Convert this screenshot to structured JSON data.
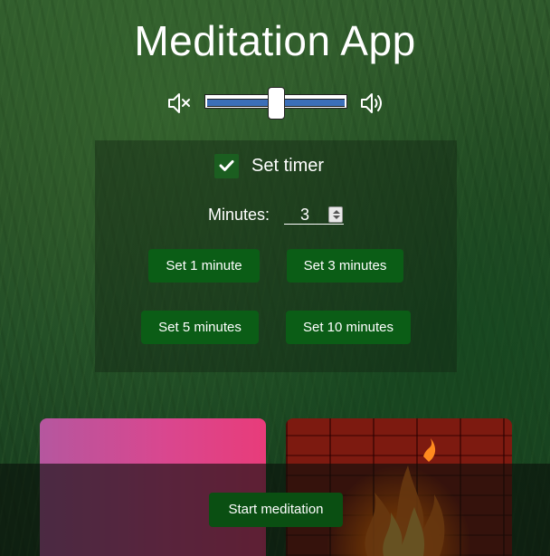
{
  "app": {
    "title": "Meditation App"
  },
  "volume": {
    "mute_icon": "speaker-muted-icon",
    "loud_icon": "speaker-loud-icon",
    "level": 0.5,
    "accent": "#3b6fb8"
  },
  "timer": {
    "checkbox_checked": true,
    "checkbox_label": "Set timer",
    "minutes_label": "Minutes:",
    "minutes_value": "3",
    "presets": [
      {
        "label": "Set 1 minute"
      },
      {
        "label": "Set 3 minutes"
      },
      {
        "label": "Set 5 minutes"
      },
      {
        "label": "Set 10 minutes"
      }
    ]
  },
  "themes": [
    {
      "name": "pink-gradient-theme",
      "color": "#d9478f"
    },
    {
      "name": "fireplace-theme",
      "color": "#7d1a10"
    }
  ],
  "actions": {
    "start_label": "Start meditation"
  },
  "colors": {
    "button": "#0b5d16",
    "checkbox": "#1b5e20"
  }
}
